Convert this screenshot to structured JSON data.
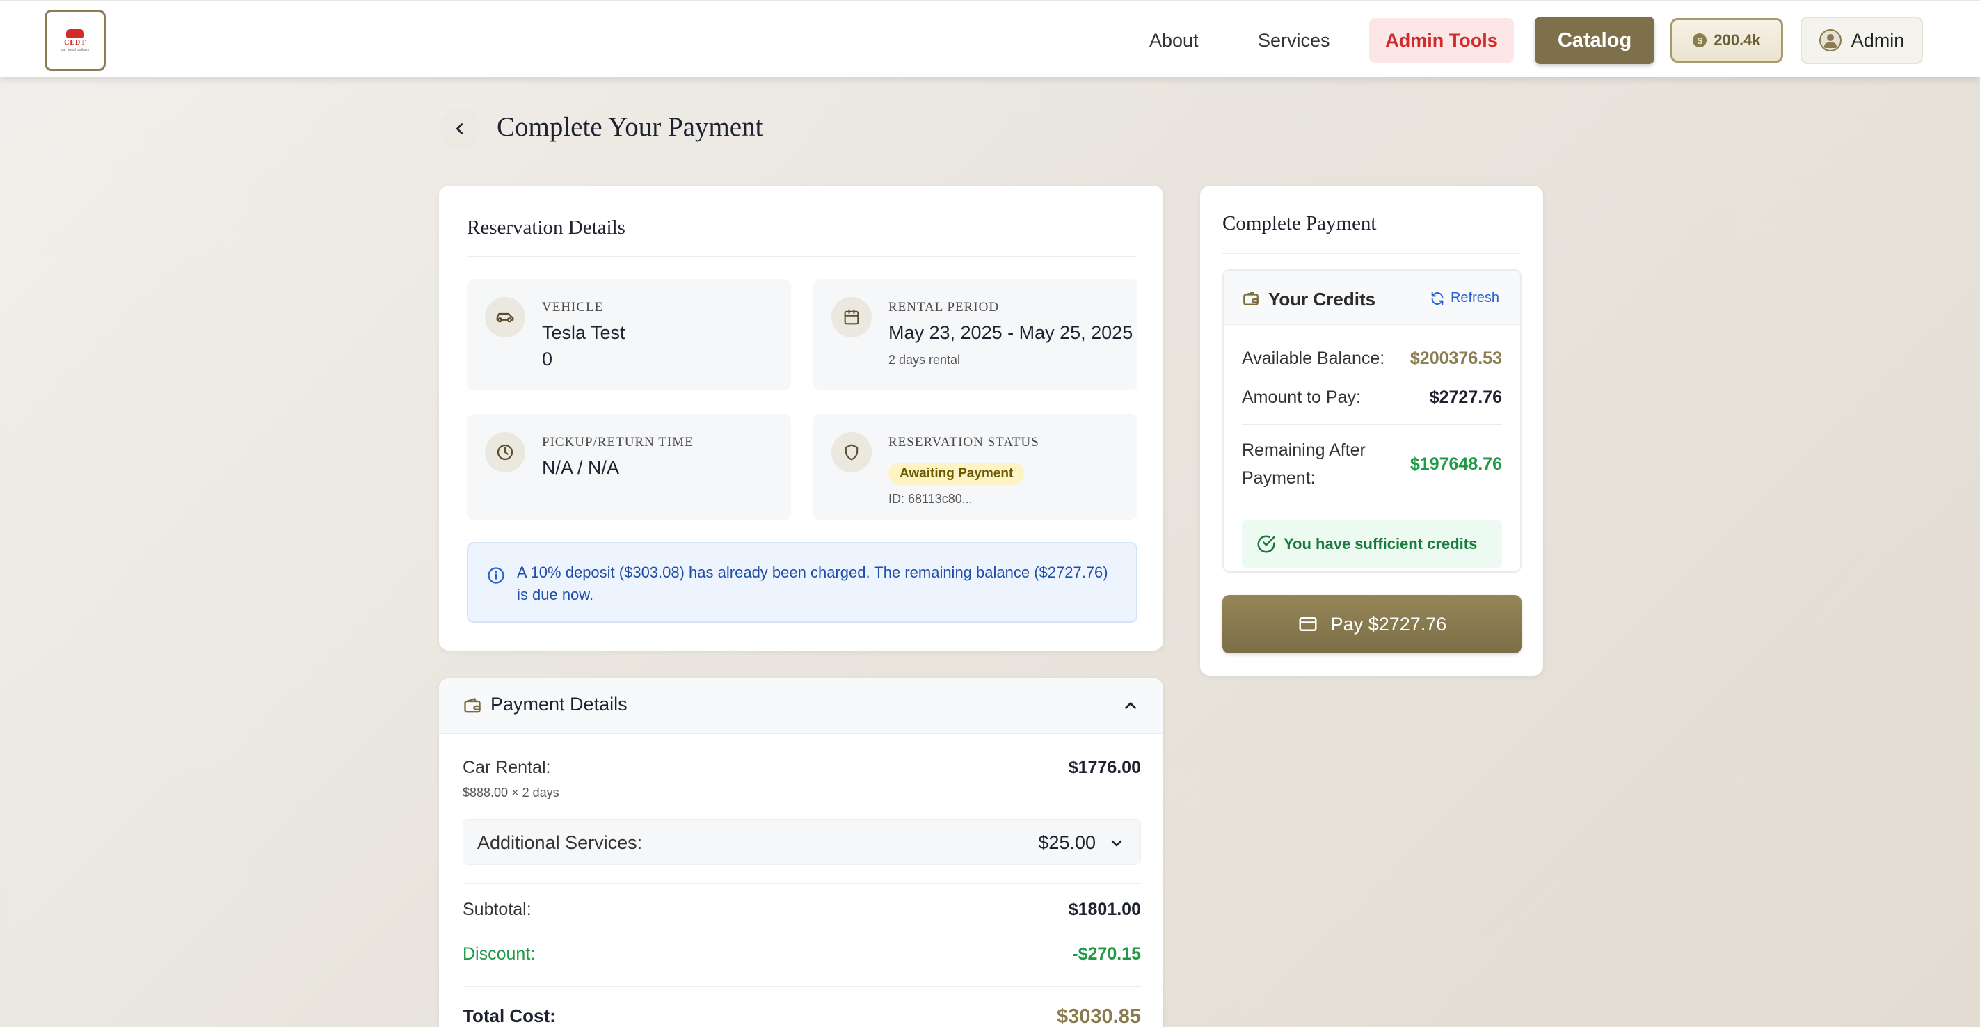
{
  "header": {
    "logo_text": "CEDT",
    "logo_sub": "car rental platform",
    "nav": {
      "about": "About",
      "services": "Services"
    },
    "admin_tools_label": "Admin Tools",
    "catalog_label": "Catalog",
    "credits_label": "200.4k",
    "credits_icon": "$",
    "user_label": "Admin"
  },
  "page": {
    "title": "Complete Your Payment"
  },
  "reservation": {
    "title": "Reservation Details",
    "vehicle": {
      "label": "VEHICLE",
      "name": "Tesla Test",
      "extra": "0"
    },
    "rental_period": {
      "label": "RENTAL PERIOD",
      "dates": "May 23, 2025 - May 25, 2025",
      "duration": "2 days rental"
    },
    "pickup_return": {
      "label": "PICKUP/RETURN TIME",
      "value": "N/A / N/A"
    },
    "status": {
      "label": "RESERVATION STATUS",
      "badge": "Awaiting Payment",
      "id": "ID: 68113c80..."
    },
    "notice": "A 10% deposit ($303.08) has already been charged. The remaining balance ($2727.76) is due now."
  },
  "payment_details": {
    "title": "Payment Details",
    "car_rental_label": "Car Rental:",
    "car_rental_value": "$1776.00",
    "car_rental_sub": "$888.00 × 2 days",
    "additional_label": "Additional Services:",
    "additional_value": "$25.00",
    "subtotal_label": "Subtotal:",
    "subtotal_value": "$1801.00",
    "discount_label": "Discount:",
    "discount_value": "-$270.15",
    "total_label": "Total Cost:",
    "total_value": "$3030.85"
  },
  "complete_payment": {
    "title": "Complete Payment",
    "credits_title": "Your Credits",
    "refresh_label": "Refresh",
    "available_label": "Available Balance:",
    "available_value": "$200376.53",
    "amount_label": "Amount to Pay:",
    "amount_value": "$2727.76",
    "remaining_label_1": "Remaining After",
    "remaining_label_2": "Payment:",
    "remaining_value": "$197648.76",
    "sufficient_text": "You have sufficient credits",
    "pay_button": "Pay $2727.76"
  },
  "colors": {
    "brand": "#7d704a",
    "accent_gold": "#8a7b50",
    "danger": "#d12a2a",
    "success": "#187a3c",
    "info": "#1e4ea8"
  },
  "icons": {
    "back": "chevron-left-icon",
    "vehicle": "car-icon",
    "calendar": "calendar-icon",
    "clock": "clock-icon",
    "shield": "shield-icon",
    "info": "info-icon",
    "wallet": "wallet-icon",
    "refresh": "refresh-icon",
    "check": "check-circle-icon",
    "card": "credit-card-icon",
    "chevron_up": "chevron-up-icon",
    "chevron_down": "chevron-down-icon"
  }
}
